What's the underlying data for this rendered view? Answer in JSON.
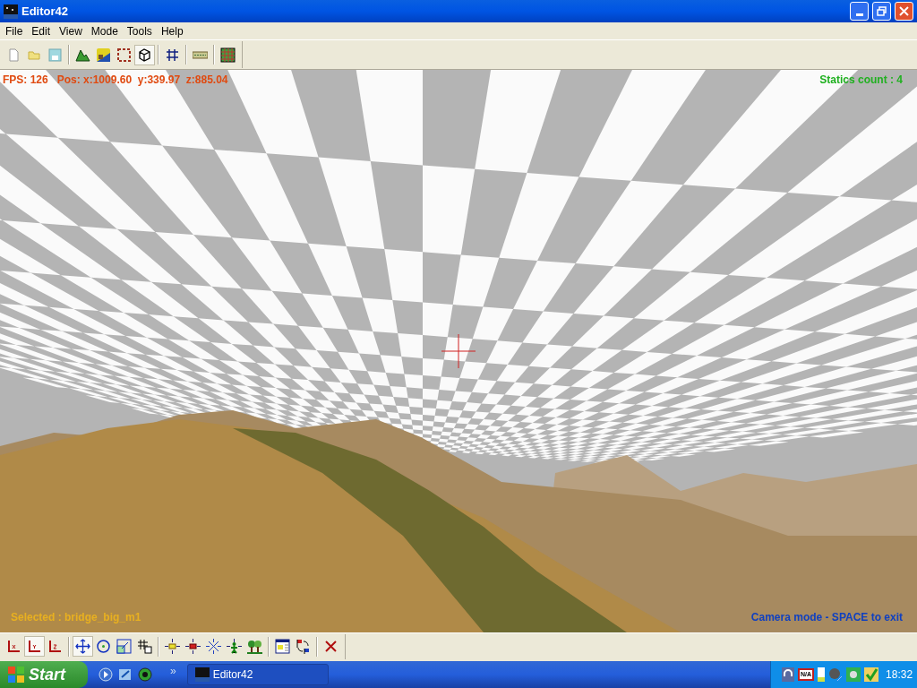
{
  "window": {
    "title": "Editor42"
  },
  "menu": [
    "File",
    "Edit",
    "View",
    "Mode",
    "Tools",
    "Help"
  ],
  "toolbar": [
    [
      {
        "kind": "new",
        "selected": false
      },
      {
        "kind": "open",
        "selected": false
      },
      {
        "kind": "save",
        "selected": false
      }
    ],
    [
      {
        "kind": "terrain",
        "selected": false
      },
      {
        "kind": "texture",
        "selected": false
      },
      {
        "kind": "area",
        "selected": false
      },
      {
        "kind": "cube",
        "selected": true
      }
    ],
    [
      {
        "kind": "grid",
        "selected": false
      }
    ],
    [
      {
        "kind": "road",
        "selected": false
      }
    ],
    [
      {
        "kind": "tiles",
        "selected": false
      }
    ]
  ],
  "viewport": {
    "stats": "FPS: 126   Pos: x:1009.60  y:339.97  z:885.04",
    "statics_count": "Statics count : 4",
    "selected": "Selected : bridge_big_m1",
    "mode": "Camera mode - SPACE to exit"
  },
  "bottom_toolbar": [
    [
      {
        "kind": "axis-x",
        "selected": false
      },
      {
        "kind": "axis-y",
        "selected": true
      },
      {
        "kind": "axis-z",
        "selected": false
      }
    ],
    [
      {
        "kind": "move",
        "selected": true
      },
      {
        "kind": "rotate",
        "selected": false
      },
      {
        "kind": "scale",
        "selected": false
      },
      {
        "kind": "snap",
        "selected": false
      }
    ],
    [
      {
        "kind": "light-box",
        "selected": false
      },
      {
        "kind": "light-flag",
        "selected": false
      },
      {
        "kind": "light-star",
        "selected": false
      },
      {
        "kind": "light-person",
        "selected": false
      },
      {
        "kind": "trees",
        "selected": false
      }
    ],
    [
      {
        "kind": "properties",
        "selected": false
      },
      {
        "kind": "swap",
        "selected": false
      }
    ],
    [
      {
        "kind": "delete",
        "selected": false
      }
    ]
  ],
  "taskbar": {
    "start": "Start",
    "chevron": "»",
    "task": "Editor42",
    "tray_label": "N/A",
    "clock": "18:32"
  }
}
